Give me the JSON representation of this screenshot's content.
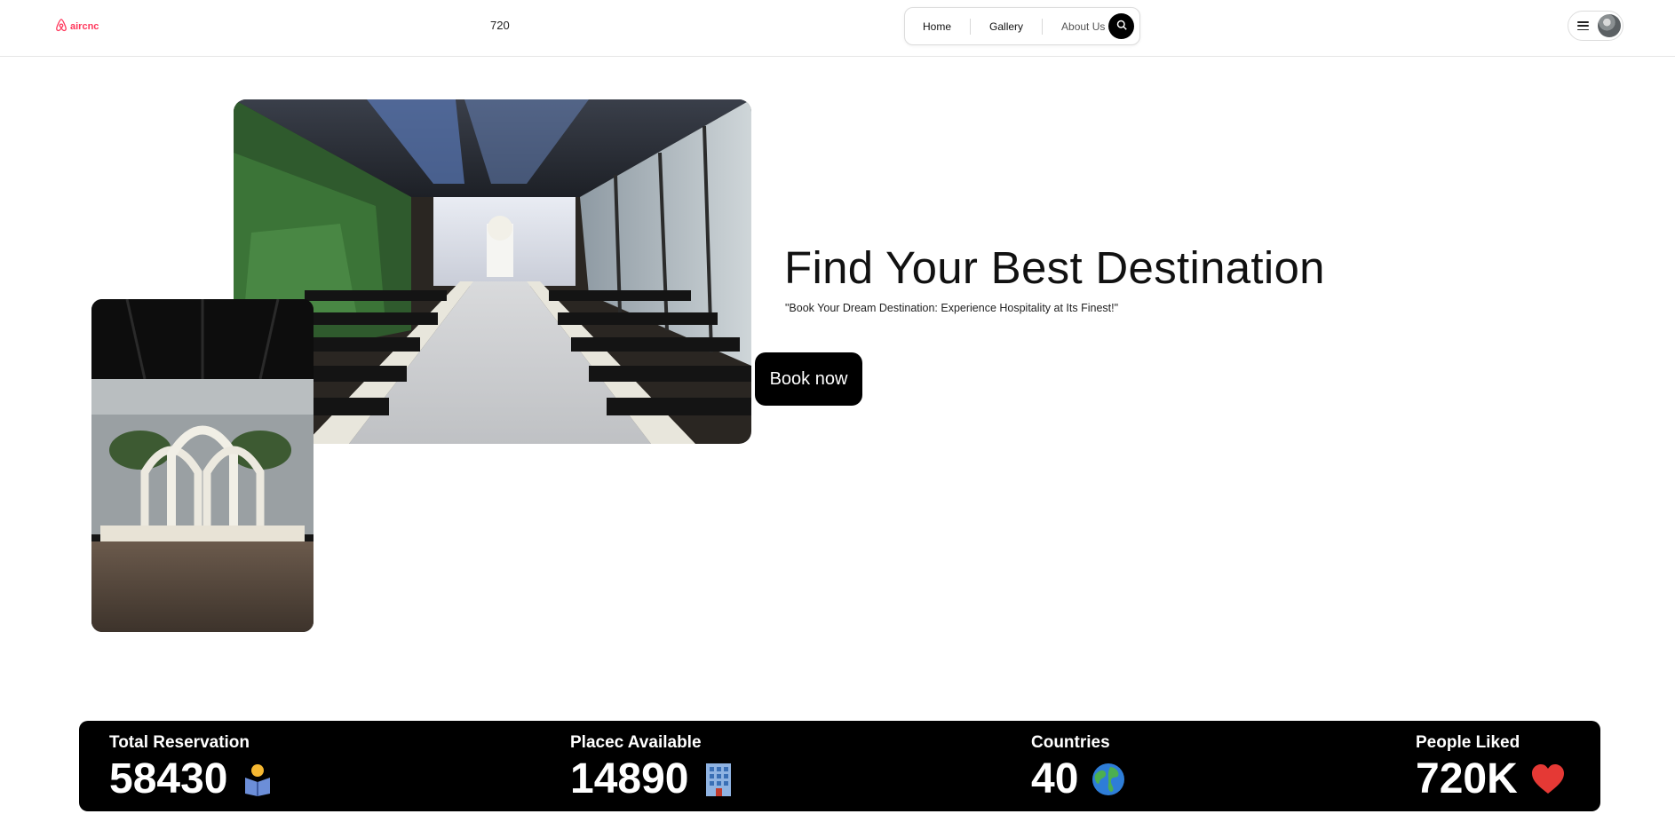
{
  "header": {
    "logo_text": "aircnc",
    "counter": "720",
    "nav": [
      {
        "label": "Home"
      },
      {
        "label": "Gallery"
      },
      {
        "label": "About Us"
      }
    ],
    "icons": {
      "logo": "airbnb-logo-icon",
      "search": "search-icon",
      "menu": "hamburger-menu-icon",
      "avatar": "user-avatar"
    }
  },
  "hero": {
    "title": "Find Your Best Destination",
    "subtitle": "\"Book Your Dream Destination: Experience Hospitality at Its Finest!\"",
    "cta_label": "Book now",
    "images": [
      "wedding-ceremony-hall-photo",
      "wedding-floral-arch-photo"
    ]
  },
  "stats": [
    {
      "label": "Total Reservation",
      "value": "58430",
      "icon": "person-reading-icon"
    },
    {
      "label": "Placec Available",
      "value": "14890",
      "icon": "office-building-icon"
    },
    {
      "label": "Countries",
      "value": "40",
      "icon": "globe-icon"
    },
    {
      "label": "People Liked",
      "value": "720K",
      "icon": "red-heart-icon"
    }
  ],
  "colors": {
    "brand": "#ff385c",
    "stats_bg": "#000000",
    "button_bg": "#000000",
    "heart": "#e53935",
    "building": "#6fa8dc",
    "globe": "#2e7dd7"
  }
}
